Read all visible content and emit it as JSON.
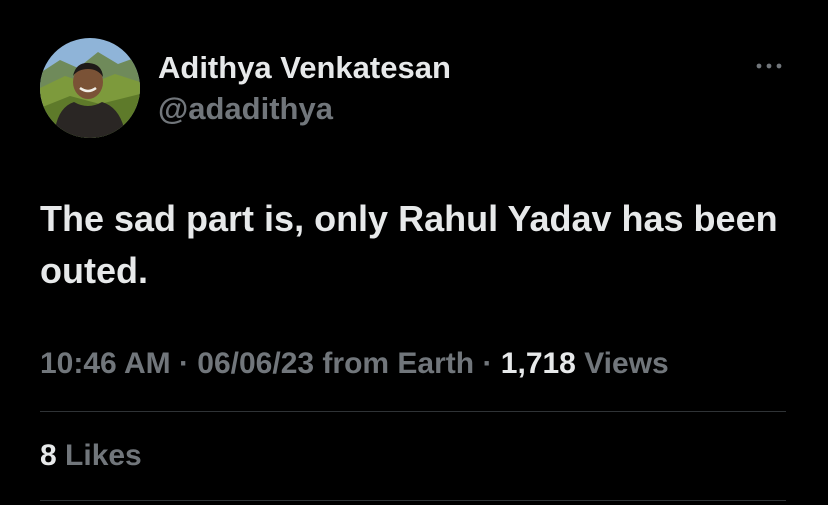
{
  "author": {
    "name": "Adithya Venkatesan",
    "handle": "@adadithya"
  },
  "tweet": {
    "text": "The sad part is, only Rahul Yadav has been outed."
  },
  "meta": {
    "time": "10:46 AM",
    "separator": "·",
    "date": "06/06/23",
    "source": "from Earth",
    "views_count": "1,718",
    "views_label": "Views"
  },
  "engagement": {
    "likes_count": "8",
    "likes_label": "Likes"
  },
  "icons": {
    "more": "more-horizontal-icon"
  },
  "colors": {
    "background": "#000000",
    "primary_text": "#e7e9ea",
    "secondary_text": "#71767b",
    "divider": "#2f3336"
  }
}
